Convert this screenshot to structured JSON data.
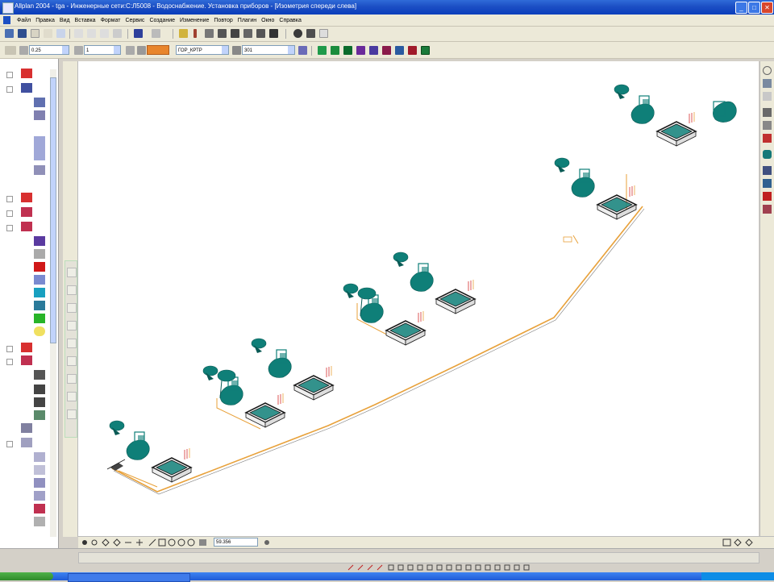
{
  "window": {
    "title": "Allplan 2004 - tga - Инженерные сети:С:Л5008 - Водоснабжение. Установка приборов - [Изометрия спереди слева]",
    "minimize": "_",
    "maximize": "□",
    "close": "✕"
  },
  "menubar": {
    "items": [
      "Файл",
      "Правка",
      "Вид",
      "Вставка",
      "Формат",
      "Сервис",
      "Создание",
      "Изменение",
      "Повтор",
      "Плагин",
      "Окно",
      "Справка"
    ]
  },
  "toolbar2": {
    "pen_label": "0.25",
    "line_label": "1",
    "layer_value": "ГОР_КРТР",
    "pattern_value": "301"
  },
  "status": {
    "zoom_value": "59.356"
  },
  "colors": {
    "fixture": "#0f7f78",
    "pipe": "#e8a13a",
    "riser_red": "#d62f2f",
    "frame": "#1a1a1a"
  },
  "icons": {
    "left_panel": [
      "tree-plus-icon",
      "layer-icon",
      "fixture-icon",
      "wc-icon",
      "pipe-icon",
      "color-swatch-icon",
      "lamp-icon",
      "camera-icon",
      "sheet-icon"
    ],
    "right_bar": [
      "zoom-icon",
      "view-icon",
      "grid-icon",
      "settings-icon",
      "palette-icon",
      "cylinder-icon",
      "layout-icon",
      "bucket-icon",
      "delete-icon",
      "refresh-icon"
    ]
  }
}
